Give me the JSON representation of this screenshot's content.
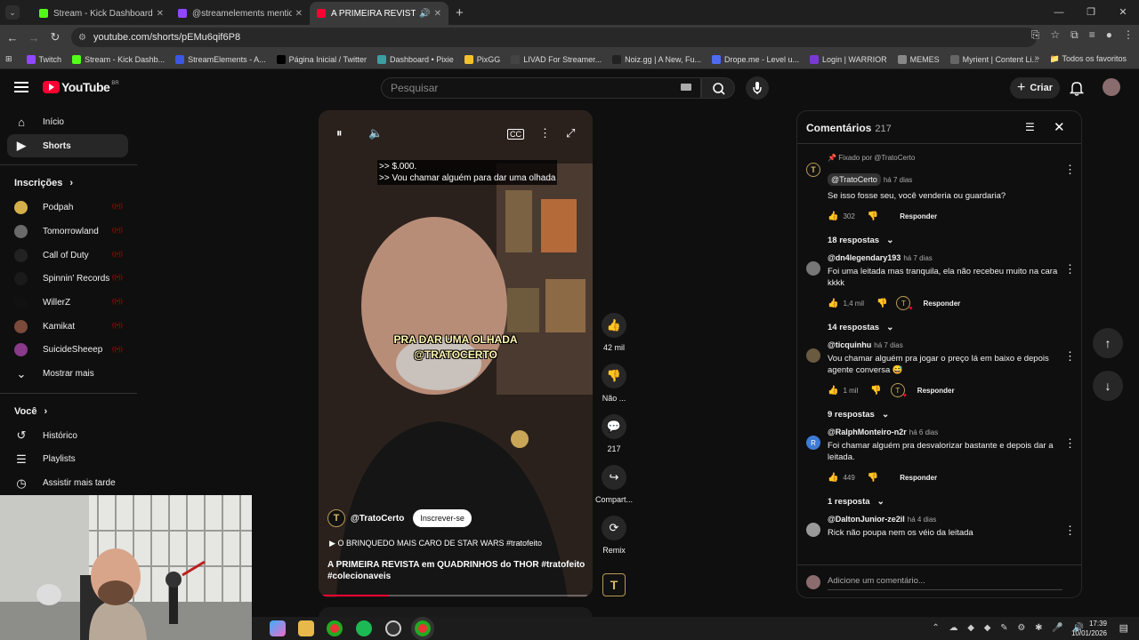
{
  "browser": {
    "tabs": [
      {
        "title": "Stream - Kick Dashboard",
        "active": false,
        "color": "#53fc18"
      },
      {
        "title": "@streamelements mentione",
        "active": false,
        "color": "#9146ff"
      },
      {
        "title": "A PRIMEIRA REVISTA em Q",
        "active": true,
        "color": "#ff0033"
      }
    ],
    "url": "youtube.com/shorts/pEMu6qif6P8",
    "bookmarks": [
      {
        "label": "Twitch",
        "color": "#9146ff"
      },
      {
        "label": "Stream - Kick Dashb...",
        "color": "#53fc18"
      },
      {
        "label": "StreamElements - A...",
        "color": "#3c57e6"
      },
      {
        "label": "Página Inicial / Twitter",
        "color": "#000000"
      },
      {
        "label": "Dashboard • Pixie",
        "color": "#3aa0a0"
      },
      {
        "label": "PixGG",
        "color": "#f2c12e"
      },
      {
        "label": "LIVAD For Streamer...",
        "color": "#444444"
      },
      {
        "label": "Noiz.gg | A New, Fu...",
        "color": "#222222"
      },
      {
        "label": "Drope.me - Level u...",
        "color": "#4f6bf0"
      },
      {
        "label": "Login | WARRIOR",
        "color": "#7a3ad0"
      },
      {
        "label": "MEMES",
        "color": "#888888"
      },
      {
        "label": "Myrient | Content Li...",
        "color": "#666666"
      }
    ],
    "bookmarks_all": "Todos os favoritos"
  },
  "youtube": {
    "logo": "YouTube",
    "region": "BR",
    "search_placeholder": "Pesquisar",
    "create_label": "Criar"
  },
  "sidebar": {
    "main": [
      {
        "label": "Início",
        "icon": "home-icon"
      },
      {
        "label": "Shorts",
        "icon": "shorts-icon",
        "active": true
      }
    ],
    "subscriptions_title": "Inscrições",
    "subscriptions": [
      {
        "label": "Podpah",
        "color": "#d4b04a"
      },
      {
        "label": "Tomorrowland",
        "color": "#6a6a6a"
      },
      {
        "label": "Call of Duty",
        "color": "#222222"
      },
      {
        "label": "Spinnin' Records",
        "color": "#1a1a1a"
      },
      {
        "label": "WillerZ",
        "color": "#111111"
      },
      {
        "label": "Kamikat",
        "color": "#7a4a3a"
      },
      {
        "label": "SuicideSheeep",
        "color": "#8a3a8a"
      }
    ],
    "show_more": "Mostrar mais",
    "you_title": "Você",
    "you": [
      {
        "label": "Histórico",
        "icon": "history-icon"
      },
      {
        "label": "Playlists",
        "icon": "playlists-icon"
      },
      {
        "label": "Assistir mais tarde",
        "icon": "watch-later-icon"
      }
    ]
  },
  "video": {
    "caption_line1": ">> $.000.",
    "caption_line2": ">> Vou chamar alguém para dar uma olhada",
    "overlay_line1": "PRA DAR UMA OLHADA",
    "overlay_line2": "@TRATOCERTO",
    "channel": "@TratoCerto",
    "channel_initial": "T",
    "subscribe": "Inscrever-se",
    "song": "O BRINQUEDO MAIS CARO DE STAR WARS #tratofeito",
    "description": "A PRIMEIRA REVISTA em QUADRINHOS do THOR",
    "tag1": "#tratofeito",
    "tag2": "#colecionaveis",
    "progress": 0.25
  },
  "actions": {
    "likes": "42 mil",
    "dislike": "Não ...",
    "comments": "217",
    "share": "Compart...",
    "remix": "Remix"
  },
  "comments": {
    "title": "Comentários",
    "count": "217",
    "pinned_by": "Fixado por @TratoCerto",
    "items": [
      {
        "author": "@TratoCerto",
        "time": "há 7 dias",
        "text": "Se isso fosse seu, você venderia ou guardaria?",
        "likes": "302",
        "replies": "18 respostas",
        "avatar": "#111111"
      },
      {
        "author": "@dn4legendary193",
        "time": "há 7 dias",
        "text": "Foi uma leitada mas tranquila, ela não recebeu muito na cara kkkk",
        "likes": "1,4 mil",
        "replies": "14 respostas",
        "avatar": "#777777"
      },
      {
        "author": "@ticquinhu",
        "time": "há 7 dias",
        "text": "Vou chamar alguém pra jogar o preço lá em baixo e depois agente conversa 😅",
        "likes": "1 mil",
        "replies": "9 respostas",
        "avatar": "#6a5a40"
      },
      {
        "author": "@RalphMonteiro-n2r",
        "time": "há 6 dias",
        "text": "Foi chamar alguém pra desvalorizar bastante e depois dar a leitada.",
        "likes": "449",
        "replies": "1 resposta",
        "avatar": "#3e7bd6"
      },
      {
        "author": "@DaltonJunior-ze2il",
        "time": "há 4 dias",
        "text": "Rick não poupa nem os véio da leitada",
        "avatar": "#999999"
      }
    ],
    "reply_label": "Responder",
    "add_placeholder": "Adicione um comentário..."
  },
  "taskbar": {
    "time": "17:39",
    "date": "10/01/2026"
  }
}
